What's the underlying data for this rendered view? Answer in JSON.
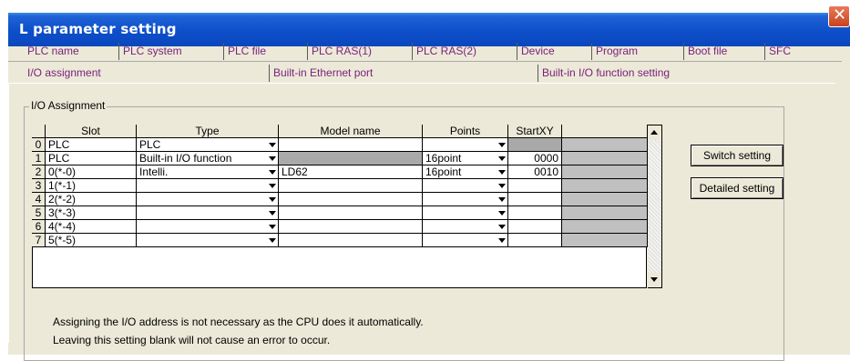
{
  "window": {
    "title": "L parameter setting",
    "close_glyph": "✕"
  },
  "tabs_row1": [
    "PLC name",
    "PLC system",
    "PLC file",
    "PLC RAS(1)",
    "PLC RAS(2)",
    "Device",
    "Program",
    "Boot file",
    "SFC"
  ],
  "tabs_row2": [
    "I/O assignment",
    "Built-in Ethernet port",
    "Built-in I/O function setting"
  ],
  "group": {
    "label": "I/O Assignment"
  },
  "table": {
    "headers": [
      "Slot",
      "Type",
      "Model name",
      "Points",
      "StartXY"
    ],
    "rows": [
      {
        "no": "0",
        "slot": "PLC",
        "type": "PLC",
        "model": "",
        "points": "",
        "start": ""
      },
      {
        "no": "1",
        "slot": "PLC",
        "type": "Built-in I/O function",
        "model": "",
        "points": "16point",
        "start": "0000"
      },
      {
        "no": "2",
        "slot": "0(*-0)",
        "type": "Intelli.",
        "model": "LD62",
        "points": "16point",
        "start": "0010"
      },
      {
        "no": "3",
        "slot": "1(*-1)",
        "type": "",
        "model": "",
        "points": "",
        "start": ""
      },
      {
        "no": "4",
        "slot": "2(*-2)",
        "type": "",
        "model": "",
        "points": "",
        "start": ""
      },
      {
        "no": "5",
        "slot": "3(*-3)",
        "type": "",
        "model": "",
        "points": "",
        "start": ""
      },
      {
        "no": "6",
        "slot": "4(*-4)",
        "type": "",
        "model": "",
        "points": "",
        "start": ""
      },
      {
        "no": "7",
        "slot": "5(*-5)",
        "type": "",
        "model": "",
        "points": "",
        "start": ""
      }
    ]
  },
  "buttons": {
    "switch_setting": "Switch setting",
    "detailed_setting": "Detailed setting"
  },
  "notes": [
    "Assigning the I/O address is not necessary as the CPU does it automatically.",
    "Leaving this setting blank will not cause an error to occur."
  ],
  "colors": {
    "title_bar": "#0d4fc9",
    "tab_text": "#7a217d",
    "dialog_bg": "#ece9d8",
    "grey_cell": "#a9a9a9"
  }
}
